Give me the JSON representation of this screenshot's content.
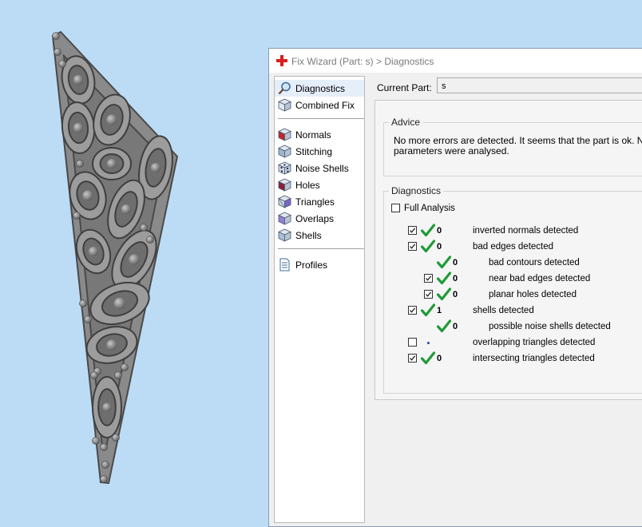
{
  "window": {
    "title": "Fix Wizard (Part: s) > Diagnostics",
    "accent_color": "#d81e1e"
  },
  "sidebar": {
    "groups": [
      [
        {
          "label": "Diagnostics",
          "icon": "magnifier-icon",
          "selected": true
        },
        {
          "label": "Combined Fix",
          "icon": "combined-fix-icon"
        }
      ],
      [
        {
          "label": "Normals",
          "icon": "normals-cube-icon"
        },
        {
          "label": "Stitching",
          "icon": "stitching-cube-icon"
        },
        {
          "label": "Noise Shells",
          "icon": "noise-shells-icon"
        },
        {
          "label": "Holes",
          "icon": "holes-cube-icon"
        },
        {
          "label": "Triangles",
          "icon": "triangles-cube-icon"
        },
        {
          "label": "Overlaps",
          "icon": "overlaps-cube-icon"
        },
        {
          "label": "Shells",
          "icon": "shells-cube-icon"
        }
      ],
      [
        {
          "label": "Profiles",
          "icon": "document-icon"
        }
      ]
    ]
  },
  "main": {
    "current_part_label": "Current Part:",
    "current_part_value": "s",
    "advice": {
      "heading": "Advice",
      "line1": "No more errors are detected. It seems that the part is ok. Not",
      "line2": "parameters were analysed."
    },
    "diagnostics": {
      "heading": "Diagnostics",
      "full_analysis_label": "Full Analysis",
      "full_analysis_checked": false,
      "rows": [
        {
          "checkbox": true,
          "checked": true,
          "status": "ok",
          "count": "0",
          "label": "inverted normals detected",
          "level": 0
        },
        {
          "checkbox": true,
          "checked": true,
          "status": "ok",
          "count": "0",
          "label": "bad edges detected",
          "level": 0
        },
        {
          "checkbox": false,
          "checked": false,
          "status": "ok",
          "count": "0",
          "label": "bad contours detected",
          "level": 1
        },
        {
          "checkbox": true,
          "checked": true,
          "status": "ok",
          "count": "0",
          "label": "near bad edges detected",
          "level": 1
        },
        {
          "checkbox": true,
          "checked": true,
          "status": "ok",
          "count": "0",
          "label": "planar holes detected",
          "level": 1
        },
        {
          "checkbox": true,
          "checked": true,
          "status": "ok",
          "count": "1",
          "label": "shells detected",
          "level": 0
        },
        {
          "checkbox": false,
          "checked": false,
          "status": "ok",
          "count": "0",
          "label": "possible noise shells detected",
          "level": 1
        },
        {
          "checkbox": true,
          "checked": false,
          "status": "pending",
          "count": "",
          "label": "overlapping triangles detected",
          "level": 0
        },
        {
          "checkbox": true,
          "checked": true,
          "status": "ok",
          "count": "0",
          "label": "intersecting triangles detected",
          "level": 0
        }
      ]
    }
  }
}
